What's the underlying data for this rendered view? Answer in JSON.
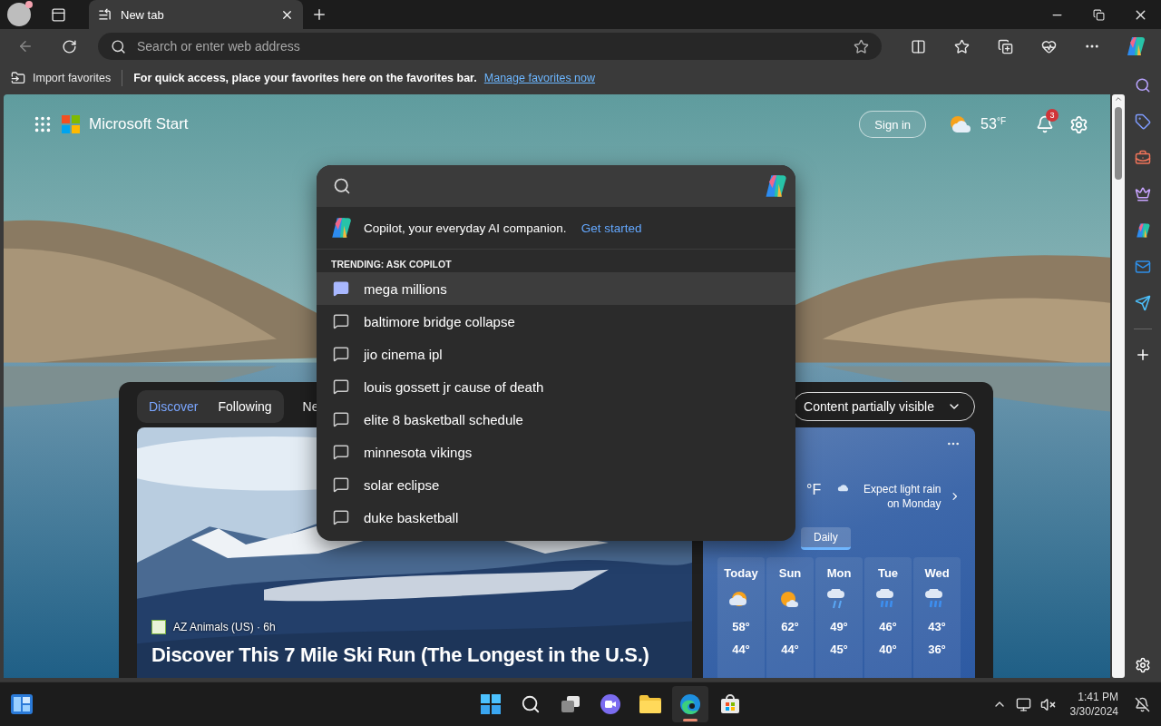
{
  "browser": {
    "tab": {
      "title": "New tab"
    },
    "address_bar": {
      "placeholder": "Search or enter web address"
    }
  },
  "favorites_bar": {
    "import_label": "Import favorites",
    "message": "For quick access, place your favorites here on the favorites bar.",
    "link": "Manage favorites now"
  },
  "start_header": {
    "brand": "Microsoft Start",
    "sign_in": "Sign in",
    "temperature": "53",
    "unit": "°F",
    "notification_count": "3"
  },
  "search_panel": {
    "promo": "Copilot, your everyday AI companion.",
    "promo_link": "Get started",
    "section_title": "TRENDING: ASK COPILOT",
    "items": [
      {
        "label": "mega millions",
        "selected": true
      },
      {
        "label": "baltimore bridge collapse",
        "selected": false
      },
      {
        "label": "jio cinema ipl",
        "selected": false
      },
      {
        "label": "louis gossett jr cause of death",
        "selected": false
      },
      {
        "label": "elite 8 basketball schedule",
        "selected": false
      },
      {
        "label": "minnesota vikings",
        "selected": false
      },
      {
        "label": "solar eclipse",
        "selected": false
      },
      {
        "label": "duke basketball",
        "selected": false
      }
    ]
  },
  "feed": {
    "tabs": [
      {
        "label": "Discover",
        "selected": true
      },
      {
        "label": "Following",
        "selected": false
      },
      {
        "label": "Ne",
        "selected": false
      }
    ],
    "visibility_menu": "Content partially visible",
    "article": {
      "meta": "AZ Animals (US) · 6h",
      "title": "Discover This 7 Mile Ski Run (The Longest in the U.S.)"
    },
    "weather": {
      "unit": "°F",
      "summary": "Expect light rain on Monday",
      "forecast_tabs": [
        {
          "label": "Daily",
          "selected": true
        }
      ],
      "days": [
        {
          "day": "Today",
          "kind": "partly-cloudy",
          "high": "58°",
          "low": "44°"
        },
        {
          "day": "Sun",
          "kind": "mostly-sunny",
          "high": "62°",
          "low": "44°"
        },
        {
          "day": "Mon",
          "kind": "rain",
          "high": "49°",
          "low": "45°"
        },
        {
          "day": "Tue",
          "kind": "showers",
          "high": "46°",
          "low": "40°"
        },
        {
          "day": "Wed",
          "kind": "showers",
          "high": "43°",
          "low": "36°"
        }
      ]
    }
  },
  "taskbar": {
    "apps": [
      {
        "kind": "start",
        "active": false
      },
      {
        "kind": "search",
        "active": false
      },
      {
        "kind": "task-view",
        "active": false
      },
      {
        "kind": "meet",
        "active": false
      },
      {
        "kind": "files",
        "active": false
      },
      {
        "kind": "edge",
        "active": true
      },
      {
        "kind": "store",
        "active": false
      }
    ],
    "time": "1:41 PM",
    "date": "3/30/2024"
  }
}
